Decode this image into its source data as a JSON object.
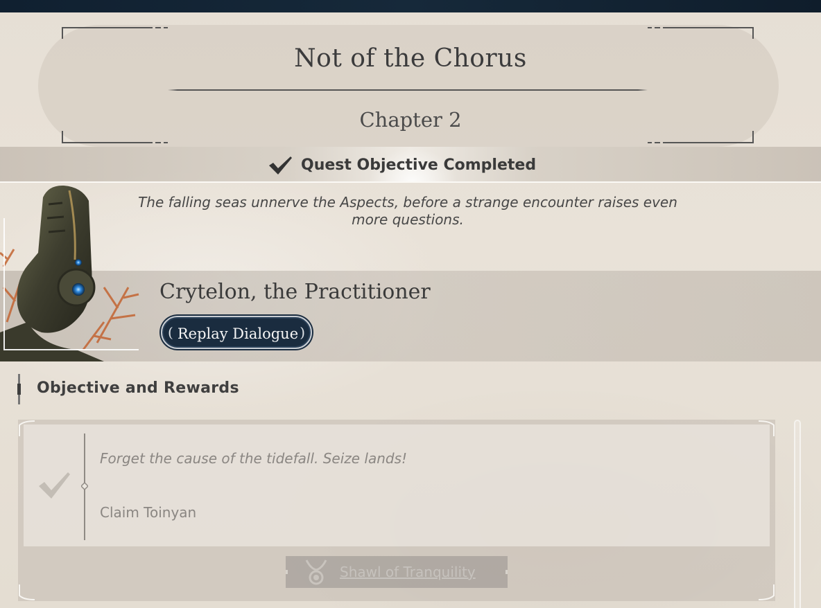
{
  "quest": {
    "title": "Not of the Chorus",
    "chapter": "Chapter 2",
    "status": "Quest Objective Completed",
    "description": "The falling seas unnerve the Aspects, before a strange encounter raises even more questions."
  },
  "npc": {
    "name": "Crytelon, the Practitioner",
    "replay_label": "Replay Dialogue",
    "paren_open": "(",
    "paren_close": ")"
  },
  "objectives_section": {
    "title": "Objective and Rewards",
    "flavor": "Forget the cause of the tidefall. Seize lands!",
    "task": "Claim Toinyan",
    "completed": true,
    "reward": {
      "label": "Shawl of Tranquility",
      "icon": "shawl-icon"
    }
  },
  "icons": {
    "status": "checkmark-icon",
    "objective": "checkmark-icon"
  },
  "colors": {
    "background": "#e7e0d6",
    "top_bar": "#16293a",
    "button_bg": "#1a2c3f",
    "text_dark": "#3a3a3a",
    "text_muted": "#8a8682"
  }
}
